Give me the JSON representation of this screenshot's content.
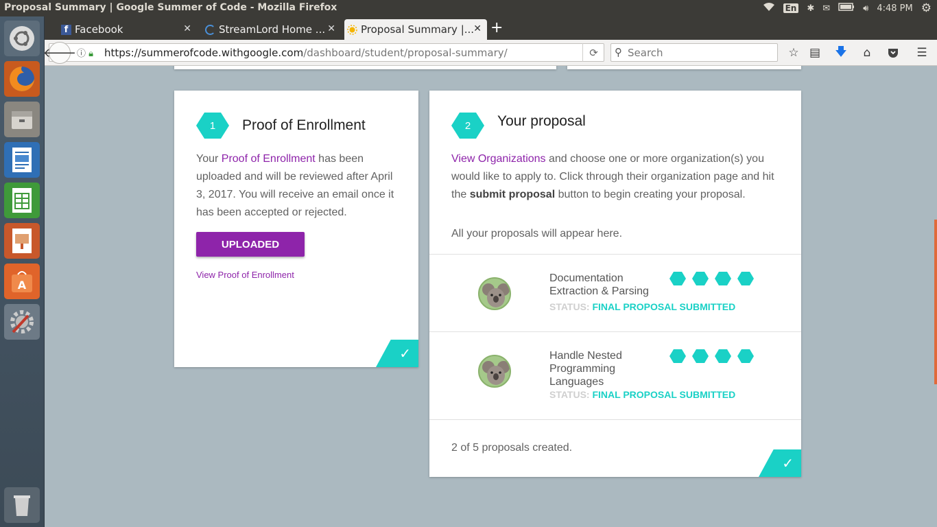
{
  "system": {
    "window_title": "Proposal Summary | Google Summer of Code - Mozilla Firefox",
    "keyboard": "En",
    "time": "4:48 PM"
  },
  "browser": {
    "tabs": [
      {
        "label": "Facebook",
        "icon": "facebook-icon"
      },
      {
        "label": "StreamLord Home ...",
        "icon": "loading-icon"
      },
      {
        "label": "Proposal Summary |...",
        "icon": "gsoc-sun-icon",
        "active": true
      }
    ],
    "url_host": "https://summerofcode.withgoogle.com",
    "url_path": "/dashboard/student/proposal-summary/",
    "search_placeholder": "Search"
  },
  "enrollment_card": {
    "step": "1",
    "title": "Proof of Enrollment",
    "text_before": "Your ",
    "text_link": "Proof of Enrollment",
    "text_after": " has been uploaded and will be reviewed after April 3, 2017. You will receive an email once it has been accepted or rejected.",
    "button_label": "UPLOADED",
    "view_link": "View Proof of Enrollment"
  },
  "proposal_card": {
    "step": "2",
    "title": "Your proposal",
    "intro_link": "View Organizations",
    "intro_text_1": " and choose one or more organization(s) you would like to apply to. Click through their organization page and hit the ",
    "intro_bold": "submit proposal",
    "intro_text_2": " button to begin creating your proposal.",
    "appear_text": "All your proposals will appear here.",
    "proposals": [
      {
        "name": "Documentation Extraction & Parsing",
        "status_label": "STATUS:",
        "status_value": "FINAL PROPOSAL SUBMITTED"
      },
      {
        "name": "Handle Nested Programming Languages",
        "status_label": "STATUS:",
        "status_value": "FINAL PROPOSAL SUBMITTED"
      }
    ],
    "footer": "2 of 5 proposals created."
  },
  "colors": {
    "accent": "#1ad1c6",
    "purple": "#8e24aa",
    "background": "#abb9c0"
  }
}
